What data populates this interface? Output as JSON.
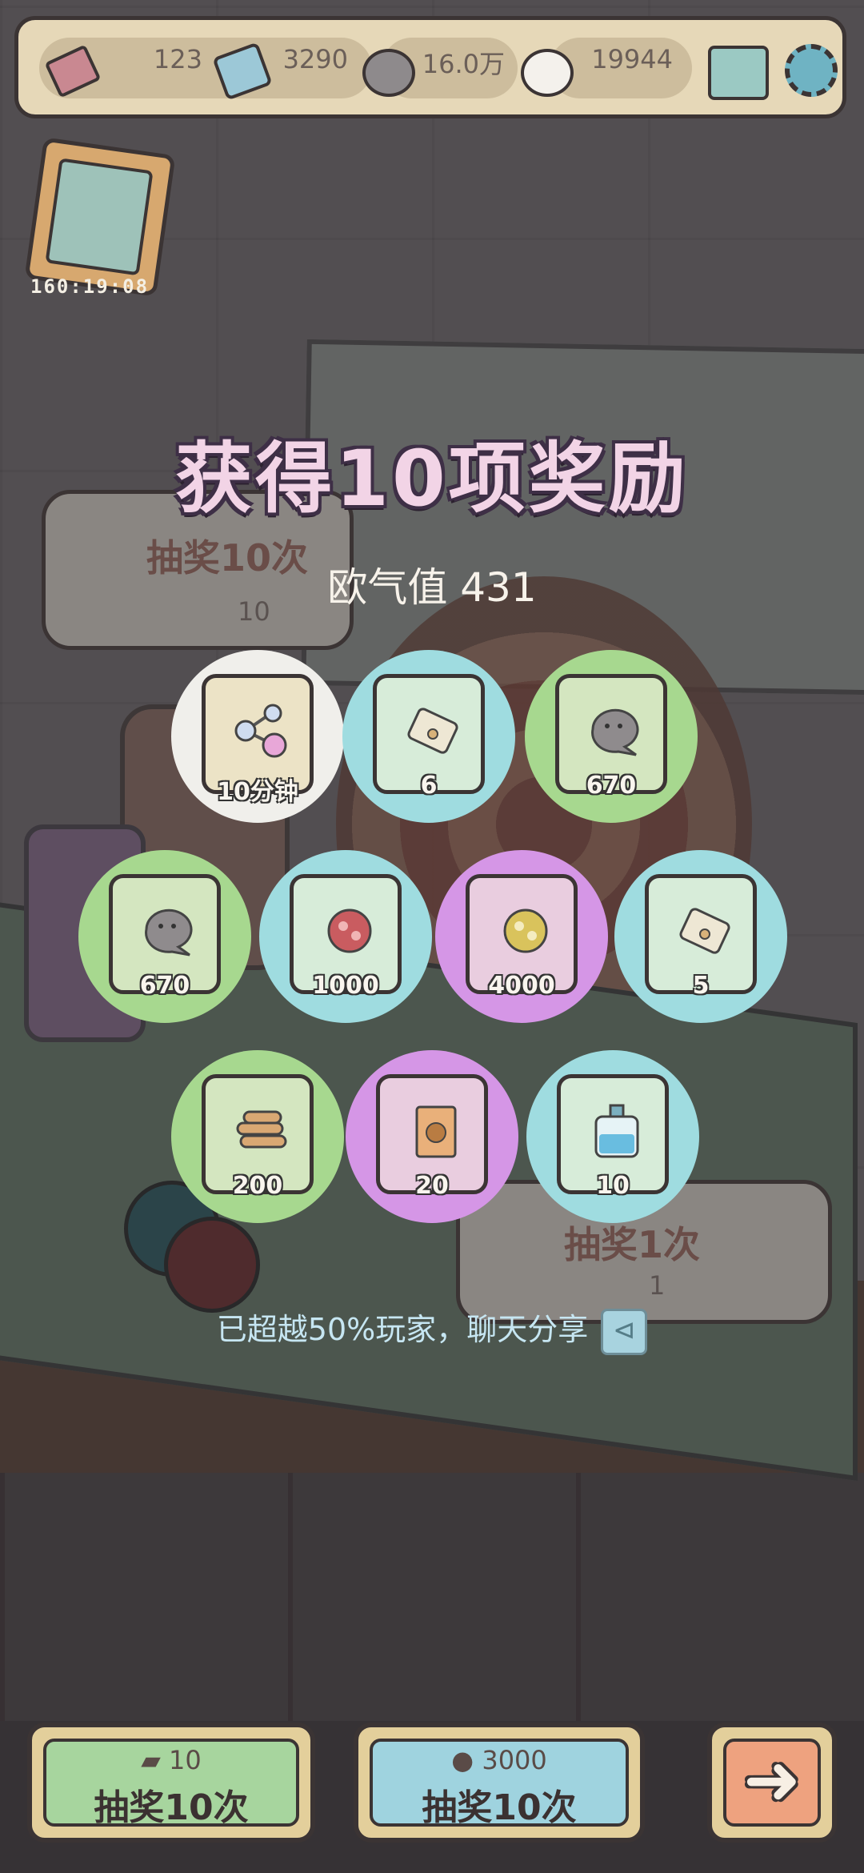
{
  "currencies": {
    "tickets": "123",
    "gems": "3290",
    "gray_bubbles": "16.0万",
    "white_bubbles": "19944"
  },
  "event_timer": "160:19:08",
  "background_buttons": {
    "draw10": {
      "label": "抽奖10次",
      "cost": "10"
    },
    "draw1": {
      "label": "抽奖1次",
      "cost": "1"
    }
  },
  "result": {
    "title": "获得10项奖励",
    "luck_label": "欧气值",
    "luck_value": "431"
  },
  "rewards": [
    {
      "qty": "10分钟",
      "bg": "#f0efeb",
      "card": "#ece3c6",
      "icon": "molecule-icon"
    },
    {
      "qty": "6",
      "bg": "#9fdce0",
      "card": "#d7ecd9",
      "icon": "scroll-icon"
    },
    {
      "qty": "670",
      "bg": "#a7d88f",
      "card": "#d4e6c0",
      "icon": "gray-bubble-icon"
    },
    {
      "qty": "670",
      "bg": "#a7d88f",
      "card": "#d4e6c0",
      "icon": "gray-bubble-icon"
    },
    {
      "qty": "1000",
      "bg": "#9fdce0",
      "card": "#d7ecd9",
      "icon": "red-virus-icon"
    },
    {
      "qty": "4000",
      "bg": "#d596e6",
      "card": "#e9cddf",
      "icon": "gold-virus-icon"
    },
    {
      "qty": "5",
      "bg": "#9fdce0",
      "card": "#d7ecd9",
      "icon": "scroll-icon"
    },
    {
      "qty": "200",
      "bg": "#a7d88f",
      "card": "#d4e6c0",
      "icon": "wood-logs-icon"
    },
    {
      "qty": "20",
      "bg": "#d596e6",
      "card": "#e9cddf",
      "icon": "book-icon"
    },
    {
      "qty": "10",
      "bg": "#9fdce0",
      "card": "#d7ecd9",
      "icon": "potion-bottle-icon"
    }
  ],
  "share_text": "已超越50%玩家，聊天分享",
  "bottom": {
    "ticket_draw": {
      "cost": "10",
      "label": "抽奖10次",
      "color": "#a7d59e"
    },
    "bubble_draw": {
      "cost": "3000",
      "label": "抽奖10次",
      "color": "#9fd3df"
    },
    "next_color": "#eea27f"
  }
}
